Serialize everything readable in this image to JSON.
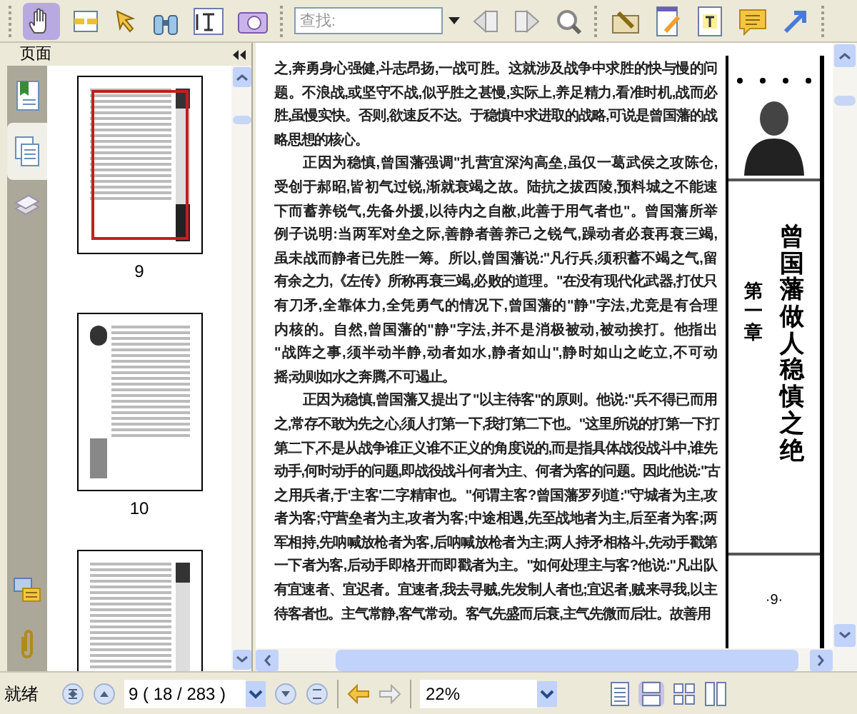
{
  "toolbar": {
    "search": {
      "placeholder": "查找:"
    }
  },
  "sidebar": {
    "title": "页面",
    "thumbnails": [
      {
        "label": "9",
        "selected": true,
        "kind": "text"
      },
      {
        "label": "10",
        "selected": false,
        "kind": "section"
      },
      {
        "kind": "text",
        "selected": false
      }
    ]
  },
  "page": {
    "paragraphs": [
      {
        "indent": false,
        "lines": [
          "之,奔勇身心强健,斗志昂扬,一战可胜。这就涉及战争中求胜的快与慢的问",
          "题。不浪战,或坚守不战,似乎胜之甚慢,实际上,养足精力,看准时机,战而必",
          "胜,虽慢实快。否则,欲速反不达。于稳慎中求进取的战略,可说是曾国藩的战",
          "略思想的核心。"
        ]
      },
      {
        "indent": true,
        "lines": [
          "正因为稳慎,曾国藩强调\"扎营宜深沟高垒,虽仅一葛武侯之攻陈仓,",
          "受创于郝昭,皆初气过锐,渐就衰竭之故。陆抗之拔西陵,预料城之不能速",
          "下而蓄养锐气,先备外援,以待内之自敝,此善于用气者也\"。曾国藩所举",
          "例子说明:当两军对垒之际,善静者善养己之锐气,躁动者必衰再衰三竭,",
          "虽未战而静者已先胜一筹。所以,曾国藩说:\"凡行兵,须积蓄不竭之气,留",
          "有余之力,《左传》所称再衰三竭,必败的道理。\"在没有现代化武器,打仗只",
          "有刀矛,全靠体力,全凭勇气的情况下,曾国藩的\"静\"字法,尤竞是有合理",
          "内核的。自然,曾国藩的\"静\"字法,并不是消极被动,被动挨打。他指出",
          "\"战阵之事,须半动半静,动者如水,静者如山\",静时如山之屹立,不可动",
          "摇;动则如水之奔腾,不可遏止。"
        ]
      },
      {
        "indent": true,
        "lines": [
          "正因为稳慎,曾国藩又提出了\"以主待客\"的原则。他说:\"兵不得已而用",
          "之,常存不敢为先之心,须人打第一下,我打第二下也。\"这里所说的打第一下打",
          "第二下,不是从战争谁正义谁不正义的角度说的,而是指具体战役战斗中,谁先",
          "动手,何时动手的问题,即战役战斗何者为主、何者为客的问题。因此他说:\"古",
          "之用兵者,于'主客'二字精审也。\"何谓主客?曾国藩罗列道:\"守城者为主,攻",
          "者为客;守营垒者为主,攻者为客;中途相遇,先至战地者为主,后至者为客;两",
          "军相持,先呐喊放枪者为客,后呐喊放枪者为主;两人持矛相格斗,先动手戳第",
          "一下者为客,后动手即格开而即戳者为主。\"如何处理主与客?他说:\"凡出队",
          "有宜速者、宜迟者。宜速者,我去寻贼,先发制人者也;宜迟者,贼来寻我,以主",
          "待客者也。主气常静,客气常动。客气先盛而后衰,主气先微而后壮。故善用"
        ]
      }
    ],
    "side_title": "曾国藩做人稳慎之绝",
    "chapter": "第一章",
    "page_number": "·9·"
  },
  "status_bar": {
    "status": "就绪",
    "page_field": "9 ( 18 / 283 )",
    "zoom": "22%"
  }
}
